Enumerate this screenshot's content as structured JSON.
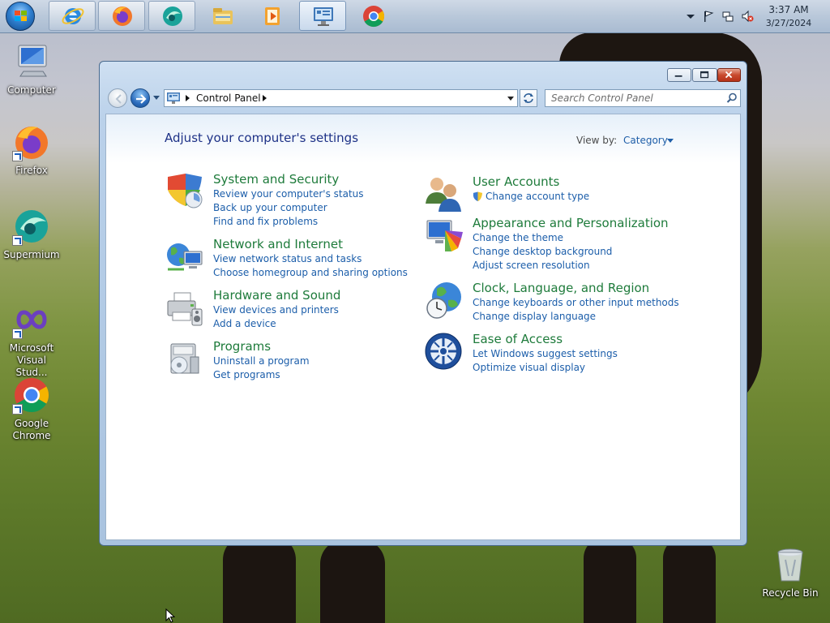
{
  "desktop": {
    "icons": [
      {
        "name": "computer",
        "label": "Computer"
      },
      {
        "name": "firefox",
        "label": "Firefox"
      },
      {
        "name": "supermium",
        "label": "Supermium"
      },
      {
        "name": "visual-studio",
        "label": "Microsoft Visual Stud..."
      },
      {
        "name": "google-chrome",
        "label": "Google Chrome"
      },
      {
        "name": "recycle-bin",
        "label": "Recycle Bin"
      }
    ]
  },
  "taskbar": {
    "pinned": [
      "internet-explorer-icon",
      "firefox-icon",
      "supermium-icon",
      "windows-explorer-icon",
      "media-player-icon",
      "control-panel-icon",
      "chrome-icon"
    ],
    "clock": {
      "time": "3:37 AM",
      "date": "3/27/2024"
    }
  },
  "window": {
    "address": {
      "crumbs": [
        "Control Panel"
      ]
    },
    "search": {
      "placeholder": "Search Control Panel"
    },
    "page_title": "Adjust your computer's settings",
    "view_by": {
      "label": "View by:",
      "value": "Category"
    },
    "categories": [
      {
        "title": "System and Security",
        "icon": "shield-icon",
        "links": [
          "Review your computer's status",
          "Back up your computer",
          "Find and fix problems"
        ]
      },
      {
        "title": "Network and Internet",
        "icon": "network-icon",
        "links": [
          "View network status and tasks",
          "Choose homegroup and sharing options"
        ]
      },
      {
        "title": "Hardware and Sound",
        "icon": "printer-icon",
        "links": [
          "View devices and printers",
          "Add a device"
        ]
      },
      {
        "title": "Programs",
        "icon": "programs-icon",
        "links": [
          "Uninstall a program",
          "Get programs"
        ]
      },
      {
        "title": "User Accounts",
        "icon": "users-icon",
        "links": [
          "Change account type"
        ]
      },
      {
        "title": "Appearance and Personalization",
        "icon": "appearance-icon",
        "links": [
          "Change the theme",
          "Change desktop background",
          "Adjust screen resolution"
        ]
      },
      {
        "title": "Clock, Language, and Region",
        "icon": "globe-clock-icon",
        "links": [
          "Change keyboards or other input methods",
          "Change display language"
        ]
      },
      {
        "title": "Ease of Access",
        "icon": "ease-of-access-icon",
        "links": [
          "Let Windows suggest settings",
          "Optimize visual display"
        ]
      }
    ]
  },
  "colors": {
    "title_green": "#1e7b3b",
    "link_blue": "#1c5eaa",
    "heading_blue": "#1e3287"
  }
}
